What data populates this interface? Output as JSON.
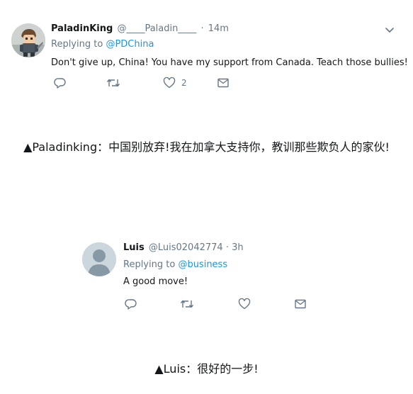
{
  "tweet1": {
    "display_name": "PaladinKing",
    "handle": "@____Paladin____",
    "separator": "·",
    "time": "14m",
    "replying_prefix": "Replying to",
    "replying_to": "@PDChina",
    "text": "Don't give up, China! You have my support from Canada. Teach those bullies!",
    "emoji_icon": "flexed-biceps-icon",
    "actions": {
      "reply_icon": "reply-icon",
      "retweet_icon": "retweet-icon",
      "like_icon": "heart-icon",
      "like_count": "2",
      "dm_icon": "envelope-icon"
    },
    "menu_icon": "chevron-down-icon"
  },
  "caption1": "▲Paladinking：中国别放弃!我在加拿大支持你，教训那些欺负人的家伙!",
  "tweet2": {
    "display_name": "Luis",
    "handle": "@Luis02042774",
    "separator": "·",
    "time": "3h",
    "replying_prefix": "Replying to",
    "replying_to": "@business",
    "text": "A good move!",
    "actions": {
      "reply_icon": "reply-icon",
      "retweet_icon": "retweet-icon",
      "like_icon": "heart-icon",
      "dm_icon": "envelope-icon"
    }
  },
  "caption2": "▲Luis：很好的一步!",
  "colors": {
    "link": "#1b95e0",
    "muted": "#657786",
    "text": "#14171a",
    "icon": "#657786",
    "default_avatar_bg": "#ccd6dd",
    "default_avatar_fg": "#8899a6"
  }
}
